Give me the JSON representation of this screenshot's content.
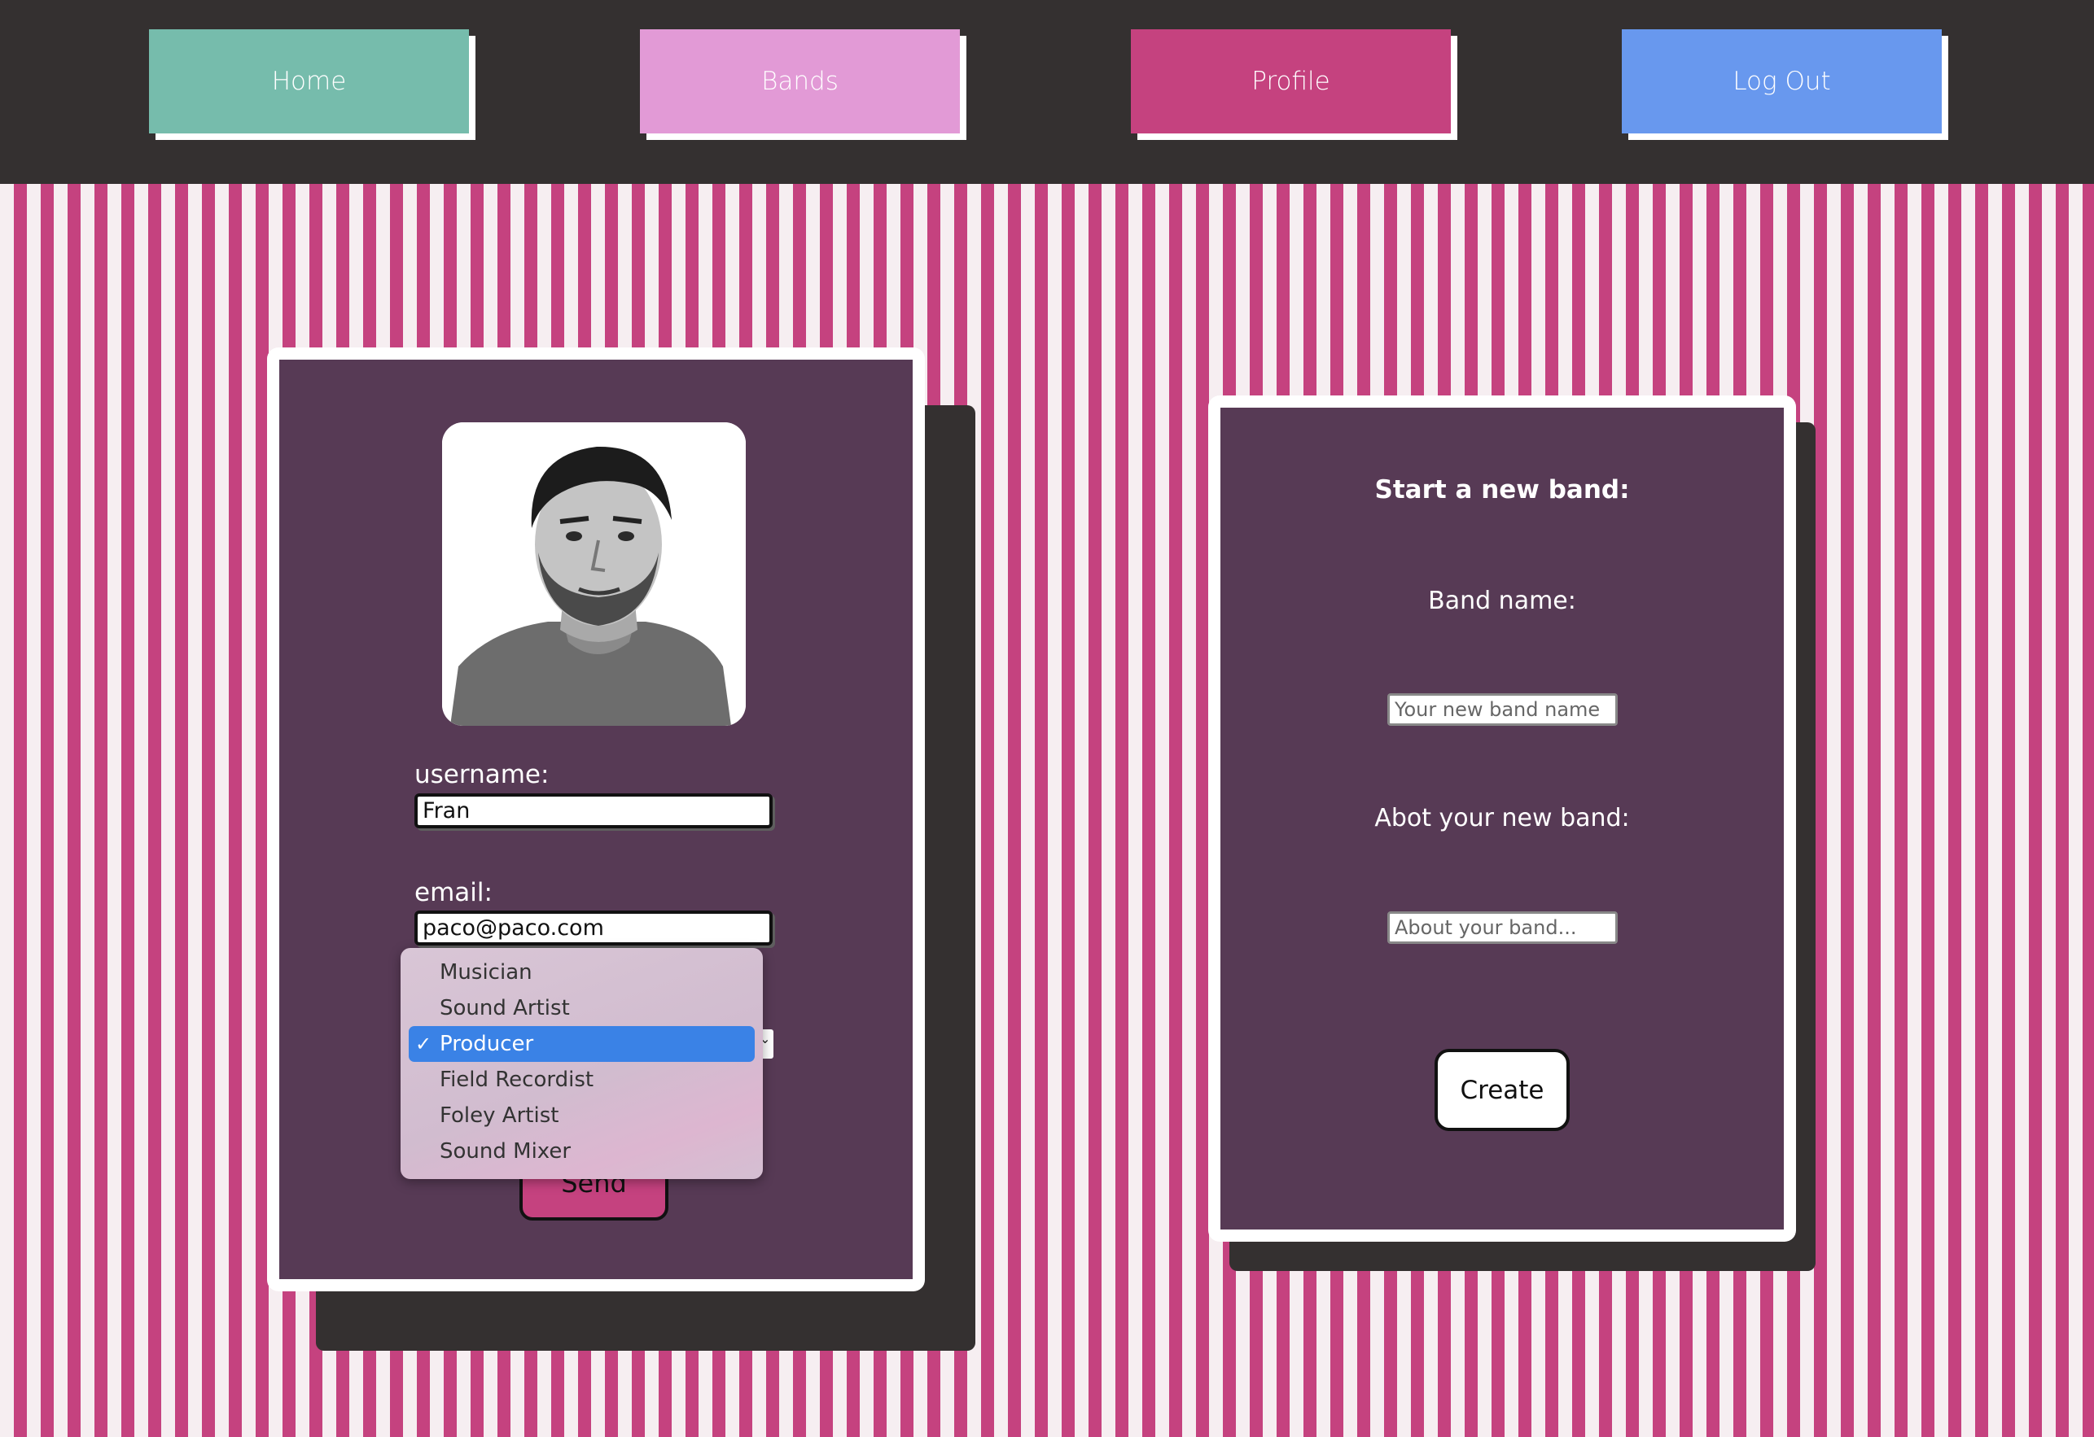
{
  "nav": {
    "home": {
      "label": "Home",
      "color": "#76bcac"
    },
    "bands": {
      "label": "Bands",
      "color": "#e29ad6"
    },
    "profile": {
      "label": "Profile",
      "color": "#c5427f"
    },
    "logout": {
      "label": "Log Out",
      "color": "#6898ee"
    }
  },
  "profile_card": {
    "avatar_icon": "person-photo",
    "username_label": "username:",
    "username_value": "Fran",
    "email_label": "email:",
    "email_value": "paco@paco.com",
    "role_options": [
      "Musician",
      "Sound Artist",
      "Producer",
      "Field Recordist",
      "Foley Artist",
      "Sound Mixer"
    ],
    "role_selected": "Producer",
    "send_label": "Send"
  },
  "band_card": {
    "title": "Start a new band:",
    "name_label": "Band name:",
    "name_placeholder": "Your new band name",
    "about_label": "Abot your new band:",
    "about_placeholder": "About your band...",
    "create_label": "Create"
  },
  "colors": {
    "card_bg": "#573a55",
    "stripe_pink": "#c5427f",
    "stripe_light": "#f6eef1",
    "topbar": "#343030",
    "selected_option": "#3a82e6"
  }
}
